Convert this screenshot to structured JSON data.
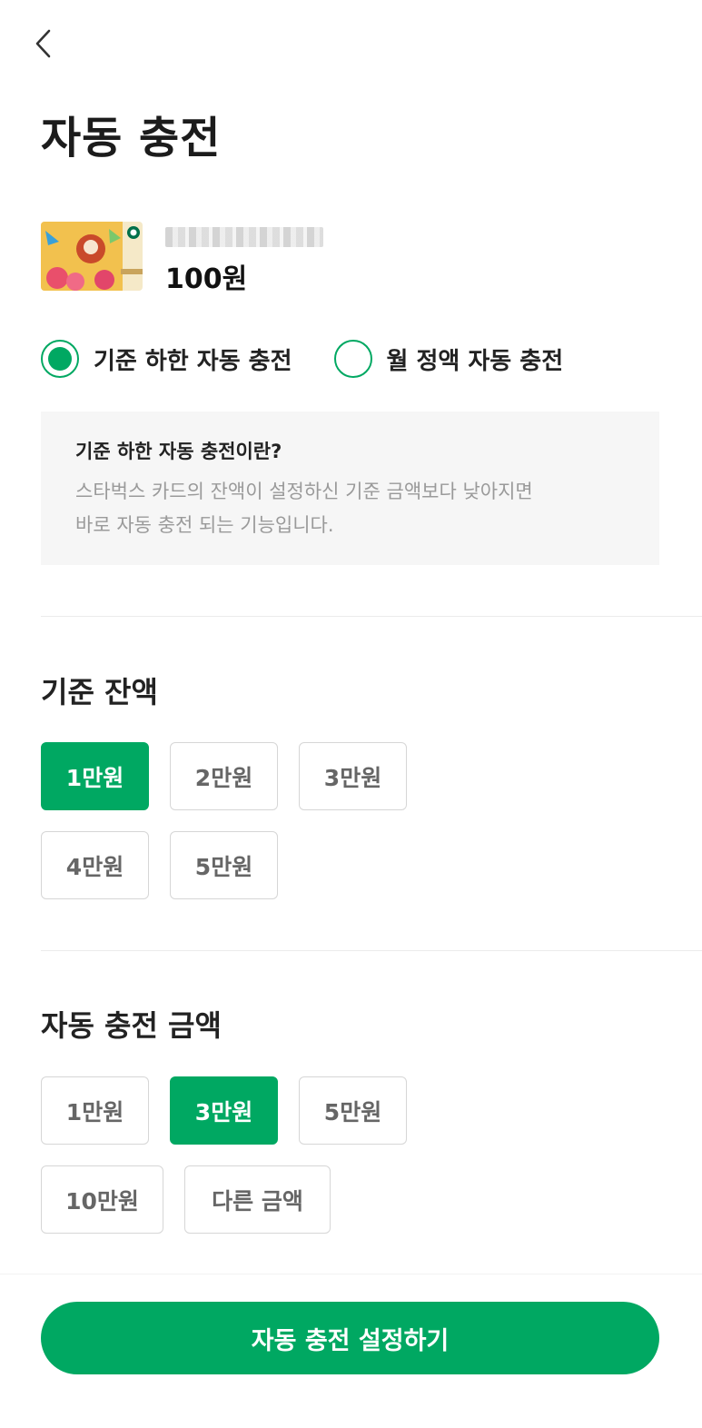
{
  "header": {
    "back_icon": "chevron-left-icon",
    "title": "자동 충전"
  },
  "card": {
    "number_masked": "",
    "balance": "100원"
  },
  "charge_type": {
    "options": [
      {
        "label": "기준 하한 자동 충전",
        "selected": true
      },
      {
        "label": "월 정액 자동 충전",
        "selected": false
      }
    ]
  },
  "info": {
    "title": "기준 하한 자동 충전이란?",
    "line1": "스타벅스 카드의 잔액이 설정하신 기준 금액보다 낮아지면",
    "line2": "바로 자동 충전 되는 기능입니다."
  },
  "threshold": {
    "title": "기준 잔액",
    "options": [
      "1만원",
      "2만원",
      "3만원",
      "4만원",
      "5만원"
    ],
    "selected_index": 0
  },
  "amount": {
    "title": "자동 충전 금액",
    "options": [
      "1만원",
      "3만원",
      "5만원",
      "10만원",
      "다른 금액"
    ],
    "selected_index": 1
  },
  "cta": {
    "label": "자동 충전 설정하기"
  },
  "colors": {
    "accent": "#00a862",
    "info_bg": "#f6f6f6",
    "muted_text": "#9a9a9a"
  }
}
